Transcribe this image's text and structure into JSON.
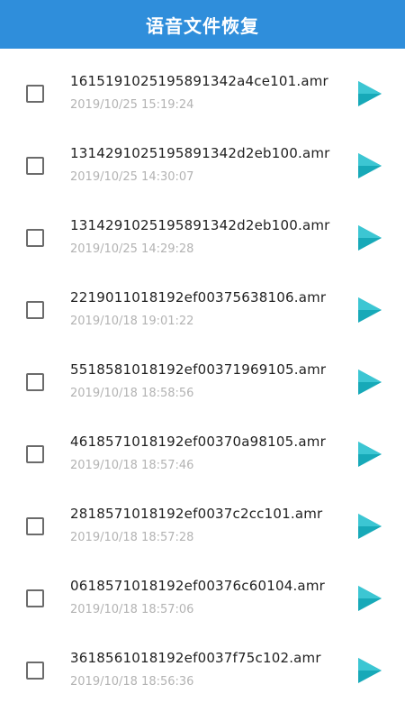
{
  "header": {
    "title": "语音文件恢复"
  },
  "colors": {
    "header_bg": "#2f8edb",
    "play_icon": "#17a9b8"
  },
  "files": [
    {
      "name": "161519102519589134 2a4ce101.amr",
      "time": "2019/10/25 15:19:24"
    },
    {
      "name": "1314291025195891342d2eb100.amr",
      "time": "2019/10/25 14:30:07"
    },
    {
      "name": "1314291025195891342d2eb100.amr",
      "time": "2019/10/25 14:29:28"
    },
    {
      "name": "2219011018192ef00375638106.amr",
      "time": "2019/10/18 19:01:22"
    },
    {
      "name": "5518581018192ef00371969105.amr",
      "time": "2019/10/18 18:58:56"
    },
    {
      "name": "4618571018192ef00370a98105.amr",
      "time": "2019/10/18 18:57:46"
    },
    {
      "name": "2818571018192ef0037c2cc101.amr",
      "time": "2019/10/18 18:57:28"
    },
    {
      "name": "0618571018192ef00376c60104.amr",
      "time": "2019/10/18 18:57:06"
    },
    {
      "name": "3618561018192ef0037f75c102.amr",
      "time": "2019/10/18 18:56:36"
    }
  ]
}
